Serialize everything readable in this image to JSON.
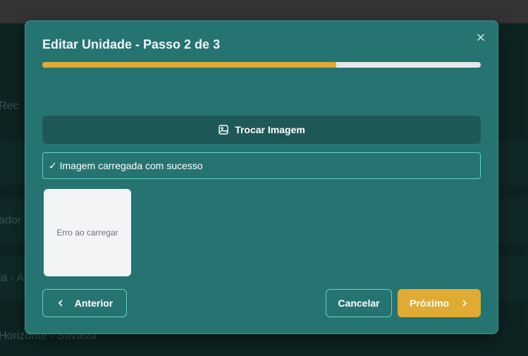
{
  "background": {
    "row_labels": [
      "Rec",
      "ador -",
      "ia - A",
      "Horizonte - Savassi"
    ]
  },
  "modal": {
    "title": "Editar Unidade - Passo 2 de 3",
    "close_icon": "close-icon",
    "progress": {
      "current_step": 2,
      "total_steps": 3,
      "fraction": 0.67
    },
    "swap_image_label": "Trocar Imagem",
    "swap_image_icon": "image-icon",
    "success_message": "✓ Imagem carregada com sucesso",
    "thumbnail_error": "Erro ao carregar",
    "buttons": {
      "previous": "Anterior",
      "cancel": "Cancelar",
      "next": "Próximo"
    }
  },
  "colors": {
    "modal_bg": "#267471",
    "accent": "#e0ab33",
    "border_accent": "#5fd3c5"
  }
}
